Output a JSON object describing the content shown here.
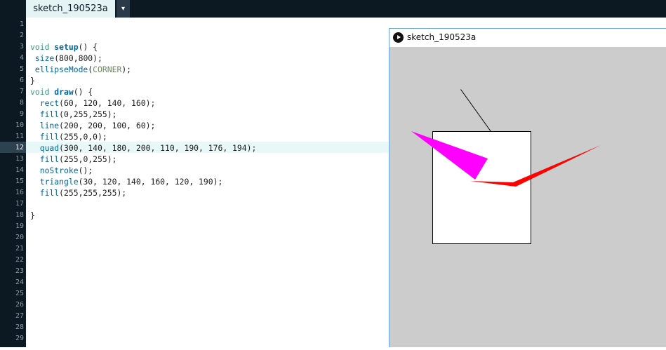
{
  "tab": {
    "name": "sketch_190523a",
    "menu_arrow": "▾"
  },
  "editor": {
    "current_line": 12,
    "line_numbers": [
      "1",
      "2",
      "3",
      "4",
      "5",
      "6",
      "7",
      "8",
      "9",
      "10",
      "11",
      "12",
      "13",
      "14",
      "15",
      "16",
      "17",
      "18",
      "19",
      "20",
      "21",
      "22",
      "23",
      "24",
      "25",
      "26",
      "27",
      "28",
      "29"
    ],
    "lines": [
      "",
      "",
      "void setup() {",
      " size(800,800);",
      " ellipseMode(CORNER);",
      "}",
      "void draw() {",
      "  rect(60, 120, 140, 160);",
      "  fill(0,255,255);",
      "  line(200, 200, 100, 60);",
      "  fill(255,0,0);",
      "  quad(300, 140, 180, 200, 110, 190, 176, 194);",
      "  fill(255,0,255);",
      "  noStroke();",
      "  triangle(30, 120, 140, 160, 120, 190);",
      "  fill(255,255,255);",
      "",
      "}"
    ]
  },
  "sketch_window": {
    "title": "sketch_190523a",
    "play_icon": "play-circle-icon",
    "background": "#cccccc",
    "colors": {
      "rect_fill": "#ffffff",
      "magenta": "#ff00ff",
      "red": "#ff0000",
      "stroke": "#000000"
    }
  }
}
